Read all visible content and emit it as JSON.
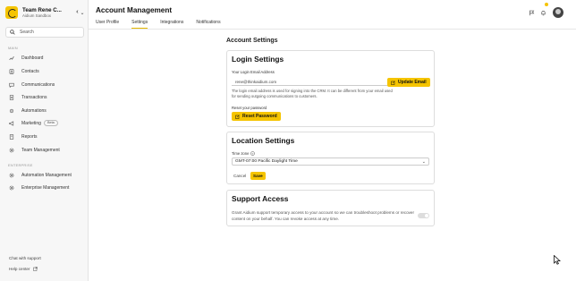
{
  "sidebar": {
    "team_name": "Team Rene C...",
    "team_sub": "Aidium Sandbox",
    "search_placeholder": "Search",
    "section_main": "MAIN",
    "section_enterprise": "ENTERPRISE",
    "items": [
      {
        "label": "Dashboard",
        "icon": "chart-icon"
      },
      {
        "label": "Contacts",
        "icon": "contacts-icon"
      },
      {
        "label": "Communications",
        "icon": "chat-icon"
      },
      {
        "label": "Transactions",
        "icon": "document-icon"
      },
      {
        "label": "Automations",
        "icon": "automation-icon"
      },
      {
        "label": "Marketing",
        "icon": "megaphone-icon",
        "badge": "Beta"
      },
      {
        "label": "Reports",
        "icon": "report-icon"
      },
      {
        "label": "Team Management",
        "icon": "gear-icon"
      }
    ],
    "enterprise_items": [
      {
        "label": "Automation Management",
        "icon": "gear-icon"
      },
      {
        "label": "Enterprise Management",
        "icon": "gear-icon"
      }
    ],
    "chat_support": "Chat with support",
    "help_center": "Help center"
  },
  "header": {
    "title": "Account Management",
    "tabs": [
      {
        "label": "User Profile",
        "active": false
      },
      {
        "label": "Settings",
        "active": true
      },
      {
        "label": "Integrations",
        "active": false
      },
      {
        "label": "Notifications",
        "active": false
      }
    ]
  },
  "main": {
    "title": "Account Settings",
    "login": {
      "heading": "Login Settings",
      "email_label": "Your Login Email Address",
      "email_value": "rene@thinkaidium.com",
      "update_button": "Update Email",
      "help_text": "The login email address is used for signing into the CRM. It can be different from your email used for sending outgoing communications to customers.",
      "reset_label": "Reset your password",
      "reset_button": "Reset Password"
    },
    "location": {
      "heading": "Location Settings",
      "timezone_label": "Time zone",
      "timezone_value": "GMT-07:00 Pacific Daylight Time",
      "cancel_button": "Cancel",
      "save_button": "Save"
    },
    "support": {
      "heading": "Support Access",
      "text": "Grant Aidium support temporary access to your account so we can troubleshoot problems or recover content on your behalf. You can revoke access at any time."
    }
  },
  "colors": {
    "accent": "#f5c400"
  }
}
